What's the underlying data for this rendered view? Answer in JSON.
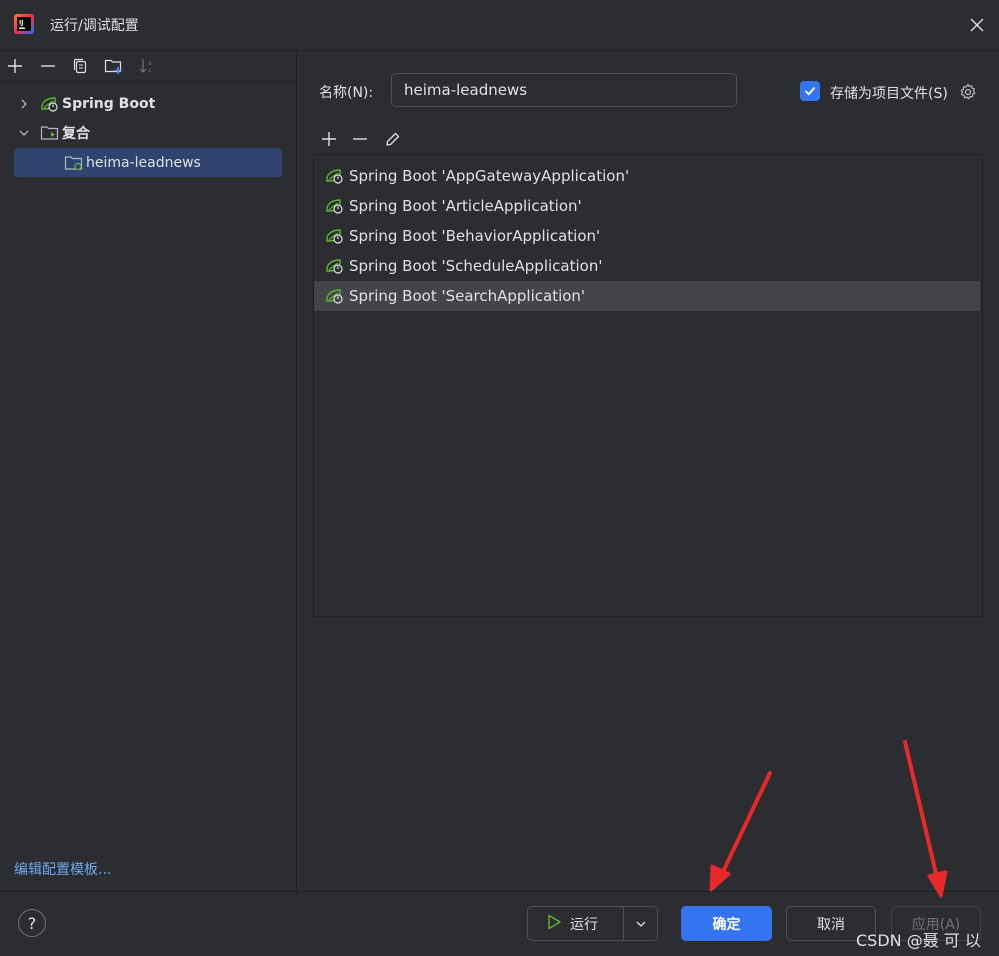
{
  "window": {
    "title": "运行/调试配置",
    "logo_icon": "intellij-logo-icon",
    "close_icon": "close-icon"
  },
  "left_toolbar": {
    "icons": [
      "add-icon",
      "remove-icon",
      "copy-icon",
      "new-folder-icon",
      "sort-icon"
    ]
  },
  "tree": {
    "items": [
      {
        "label": "Spring Boot",
        "expanded": false,
        "icon": "spring-boot-icon"
      },
      {
        "label": "复合",
        "expanded": true,
        "icon": "compound-folder-icon"
      },
      {
        "label": "heima-leadnews",
        "selected": true,
        "icon": "compound-config-icon"
      }
    ]
  },
  "edit_templates_link": "编辑配置模板...",
  "form": {
    "name_label": "名称(N):",
    "name_value": "heima-leadnews",
    "store_as_project_file": {
      "label": "存储为项目文件(S)",
      "checked": true
    }
  },
  "list_toolbar": {
    "icons": [
      "add-icon",
      "remove-icon",
      "edit-icon"
    ]
  },
  "configurations": [
    {
      "label": "Spring Boot 'AppGatewayApplication'"
    },
    {
      "label": "Spring Boot 'ArticleApplication'"
    },
    {
      "label": "Spring Boot 'BehaviorApplication'"
    },
    {
      "label": "Spring Boot 'ScheduleApplication'"
    },
    {
      "label": "Spring Boot 'SearchApplication'",
      "highlighted": true
    }
  ],
  "footer": {
    "help": "?",
    "run": "运行",
    "ok": "确定",
    "cancel": "取消",
    "apply": "应用(A)",
    "watermark": "CSDN @聂 可 以"
  },
  "colors": {
    "background": "#2b2d30",
    "accent": "#3574f0",
    "selection": "#2e436e",
    "link": "#6fa7f2",
    "spring_green": "#5fb832",
    "annotation_red": "#e8282b"
  }
}
